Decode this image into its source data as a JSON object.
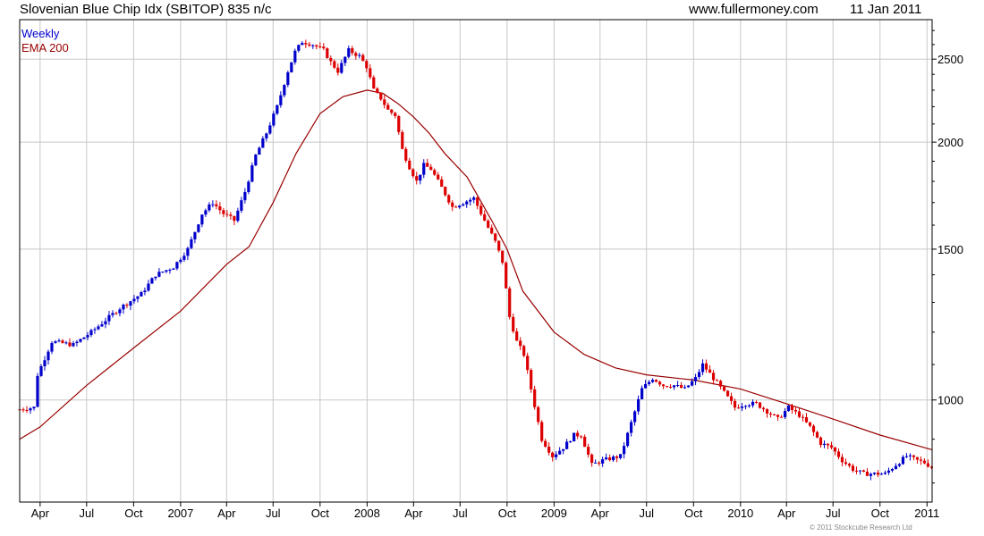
{
  "header": {
    "title": "Slovenian Blue Chip Idx (SBITOP) 835 n/c",
    "website": "www.fullermoney.com",
    "date": "11 Jan 2011"
  },
  "footer": {
    "copyright": "© 2011 Stockcube Research Ltd"
  },
  "colors": {
    "up": "#0000cc",
    "down": "#dd0000",
    "ema": "#990000",
    "grid": "#c8c8c8",
    "axis": "#000000"
  },
  "chart_data": {
    "type": "line",
    "subtype": "weekly candlestick with moving average",
    "x_axis": {
      "type": "date",
      "range": [
        "2006-02-20",
        "2011-01-11"
      ],
      "ticks": [
        {
          "date": "2006-04-01",
          "label": "Apr"
        },
        {
          "date": "2006-07-01",
          "label": "Jul"
        },
        {
          "date": "2006-10-01",
          "label": "Oct"
        },
        {
          "date": "2007-01-01",
          "label": "2007"
        },
        {
          "date": "2007-04-01",
          "label": "Apr"
        },
        {
          "date": "2007-07-01",
          "label": "Jul"
        },
        {
          "date": "2007-10-01",
          "label": "Oct"
        },
        {
          "date": "2008-01-01",
          "label": "2008"
        },
        {
          "date": "2008-04-01",
          "label": "Apr"
        },
        {
          "date": "2008-07-01",
          "label": "Jul"
        },
        {
          "date": "2008-10-01",
          "label": "Oct"
        },
        {
          "date": "2009-01-01",
          "label": "2009"
        },
        {
          "date": "2009-04-01",
          "label": "Apr"
        },
        {
          "date": "2009-07-01",
          "label": "Jul"
        },
        {
          "date": "2009-10-01",
          "label": "Oct"
        },
        {
          "date": "2010-01-01",
          "label": "2010"
        },
        {
          "date": "2010-04-01",
          "label": "Apr"
        },
        {
          "date": "2010-07-01",
          "label": "Jul"
        },
        {
          "date": "2010-10-01",
          "label": "Oct"
        },
        {
          "date": "2011-01-01",
          "label": "2011"
        }
      ]
    },
    "y_axis": {
      "type": "log",
      "range": [
        760,
        2780
      ],
      "ticks": [
        1000,
        1500,
        2000,
        2500
      ],
      "position": "right"
    },
    "grid": true,
    "legend": {
      "position": "top-left",
      "entries": [
        "Weekly",
        "EMA 200"
      ]
    },
    "series": [
      {
        "name": "Weekly",
        "kind": "candlestick",
        "key_points": [
          [
            "2006-02-20",
            975
          ],
          [
            "2006-03-20",
            980
          ],
          [
            "2006-03-27",
            1070
          ],
          [
            "2006-04-24",
            1170
          ],
          [
            "2006-06-05",
            1160
          ],
          [
            "2006-07-10",
            1200
          ],
          [
            "2006-09-04",
            1280
          ],
          [
            "2006-10-16",
            1330
          ],
          [
            "2006-11-13",
            1400
          ],
          [
            "2006-12-18",
            1430
          ],
          [
            "2007-01-15",
            1500
          ],
          [
            "2007-02-12",
            1650
          ],
          [
            "2007-03-05",
            1700
          ],
          [
            "2007-03-26",
            1650
          ],
          [
            "2007-04-16",
            1620
          ],
          [
            "2007-05-07",
            1750
          ],
          [
            "2007-05-28",
            1930
          ],
          [
            "2007-06-18",
            2050
          ],
          [
            "2007-07-09",
            2200
          ],
          [
            "2007-07-30",
            2420
          ],
          [
            "2007-08-13",
            2550
          ],
          [
            "2007-08-27",
            2620
          ],
          [
            "2007-09-17",
            2600
          ],
          [
            "2007-10-08",
            2560
          ],
          [
            "2007-10-22",
            2480
          ],
          [
            "2007-11-05",
            2420
          ],
          [
            "2007-11-26",
            2560
          ],
          [
            "2007-12-17",
            2520
          ],
          [
            "2007-12-31",
            2450
          ],
          [
            "2008-01-14",
            2300
          ],
          [
            "2008-01-28",
            2250
          ],
          [
            "2008-02-11",
            2180
          ],
          [
            "2008-02-25",
            2150
          ],
          [
            "2008-03-10",
            1960
          ],
          [
            "2008-03-24",
            1870
          ],
          [
            "2008-04-07",
            1800
          ],
          [
            "2008-04-21",
            1880
          ],
          [
            "2008-05-05",
            1860
          ],
          [
            "2008-05-26",
            1770
          ],
          [
            "2008-06-16",
            1680
          ],
          [
            "2008-07-07",
            1700
          ],
          [
            "2008-07-28",
            1720
          ],
          [
            "2008-08-18",
            1620
          ],
          [
            "2008-09-08",
            1530
          ],
          [
            "2008-09-22",
            1450
          ],
          [
            "2008-10-06",
            1250
          ],
          [
            "2008-10-20",
            1170
          ],
          [
            "2008-11-03",
            1130
          ],
          [
            "2008-11-17",
            1030
          ],
          [
            "2008-12-08",
            900
          ],
          [
            "2008-12-29",
            860
          ],
          [
            "2009-01-19",
            880
          ],
          [
            "2009-02-09",
            910
          ],
          [
            "2009-02-23",
            910
          ],
          [
            "2009-03-16",
            840
          ],
          [
            "2009-04-06",
            850
          ],
          [
            "2009-05-11",
            860
          ],
          [
            "2009-06-01",
            940
          ],
          [
            "2009-06-22",
            1030
          ],
          [
            "2009-07-13",
            1060
          ],
          [
            "2009-08-03",
            1040
          ],
          [
            "2009-08-24",
            1040
          ],
          [
            "2009-09-14",
            1030
          ],
          [
            "2009-10-05",
            1060
          ],
          [
            "2009-10-19",
            1100
          ],
          [
            "2009-11-09",
            1060
          ],
          [
            "2009-11-30",
            1020
          ],
          [
            "2009-12-21",
            980
          ],
          [
            "2010-01-11",
            990
          ],
          [
            "2010-02-01",
            990
          ],
          [
            "2010-02-22",
            970
          ],
          [
            "2010-03-15",
            950
          ],
          [
            "2010-04-05",
            980
          ],
          [
            "2010-04-26",
            960
          ],
          [
            "2010-05-17",
            930
          ],
          [
            "2010-06-07",
            890
          ],
          [
            "2010-06-28",
            880
          ],
          [
            "2010-07-19",
            850
          ],
          [
            "2010-08-09",
            830
          ],
          [
            "2010-08-30",
            820
          ],
          [
            "2010-09-20",
            820
          ],
          [
            "2010-10-11",
            820
          ],
          [
            "2010-11-01",
            840
          ],
          [
            "2010-11-22",
            860
          ],
          [
            "2010-12-13",
            850
          ],
          [
            "2010-12-27",
            845
          ],
          [
            "2011-01-10",
            835
          ]
        ]
      },
      {
        "name": "EMA 200",
        "kind": "line",
        "points": [
          [
            "2006-02-20",
            900
          ],
          [
            "2006-04-01",
            930
          ],
          [
            "2006-07-01",
            1040
          ],
          [
            "2006-10-01",
            1150
          ],
          [
            "2007-01-01",
            1270
          ],
          [
            "2007-04-01",
            1440
          ],
          [
            "2007-05-15",
            1510
          ],
          [
            "2007-07-01",
            1700
          ],
          [
            "2007-08-15",
            1940
          ],
          [
            "2007-10-01",
            2160
          ],
          [
            "2007-11-15",
            2260
          ],
          [
            "2008-01-01",
            2300
          ],
          [
            "2008-02-01",
            2280
          ],
          [
            "2008-03-01",
            2220
          ],
          [
            "2008-04-01",
            2140
          ],
          [
            "2008-05-01",
            2050
          ],
          [
            "2008-06-01",
            1940
          ],
          [
            "2008-07-15",
            1820
          ],
          [
            "2008-09-01",
            1620
          ],
          [
            "2008-10-01",
            1500
          ],
          [
            "2008-11-01",
            1340
          ],
          [
            "2009-01-01",
            1200
          ],
          [
            "2009-03-01",
            1130
          ],
          [
            "2009-05-01",
            1090
          ],
          [
            "2009-07-01",
            1070
          ],
          [
            "2009-10-01",
            1055
          ],
          [
            "2010-01-01",
            1030
          ],
          [
            "2010-04-01",
            990
          ],
          [
            "2010-07-01",
            950
          ],
          [
            "2010-10-01",
            910
          ],
          [
            "2011-01-10",
            875
          ]
        ]
      }
    ]
  }
}
